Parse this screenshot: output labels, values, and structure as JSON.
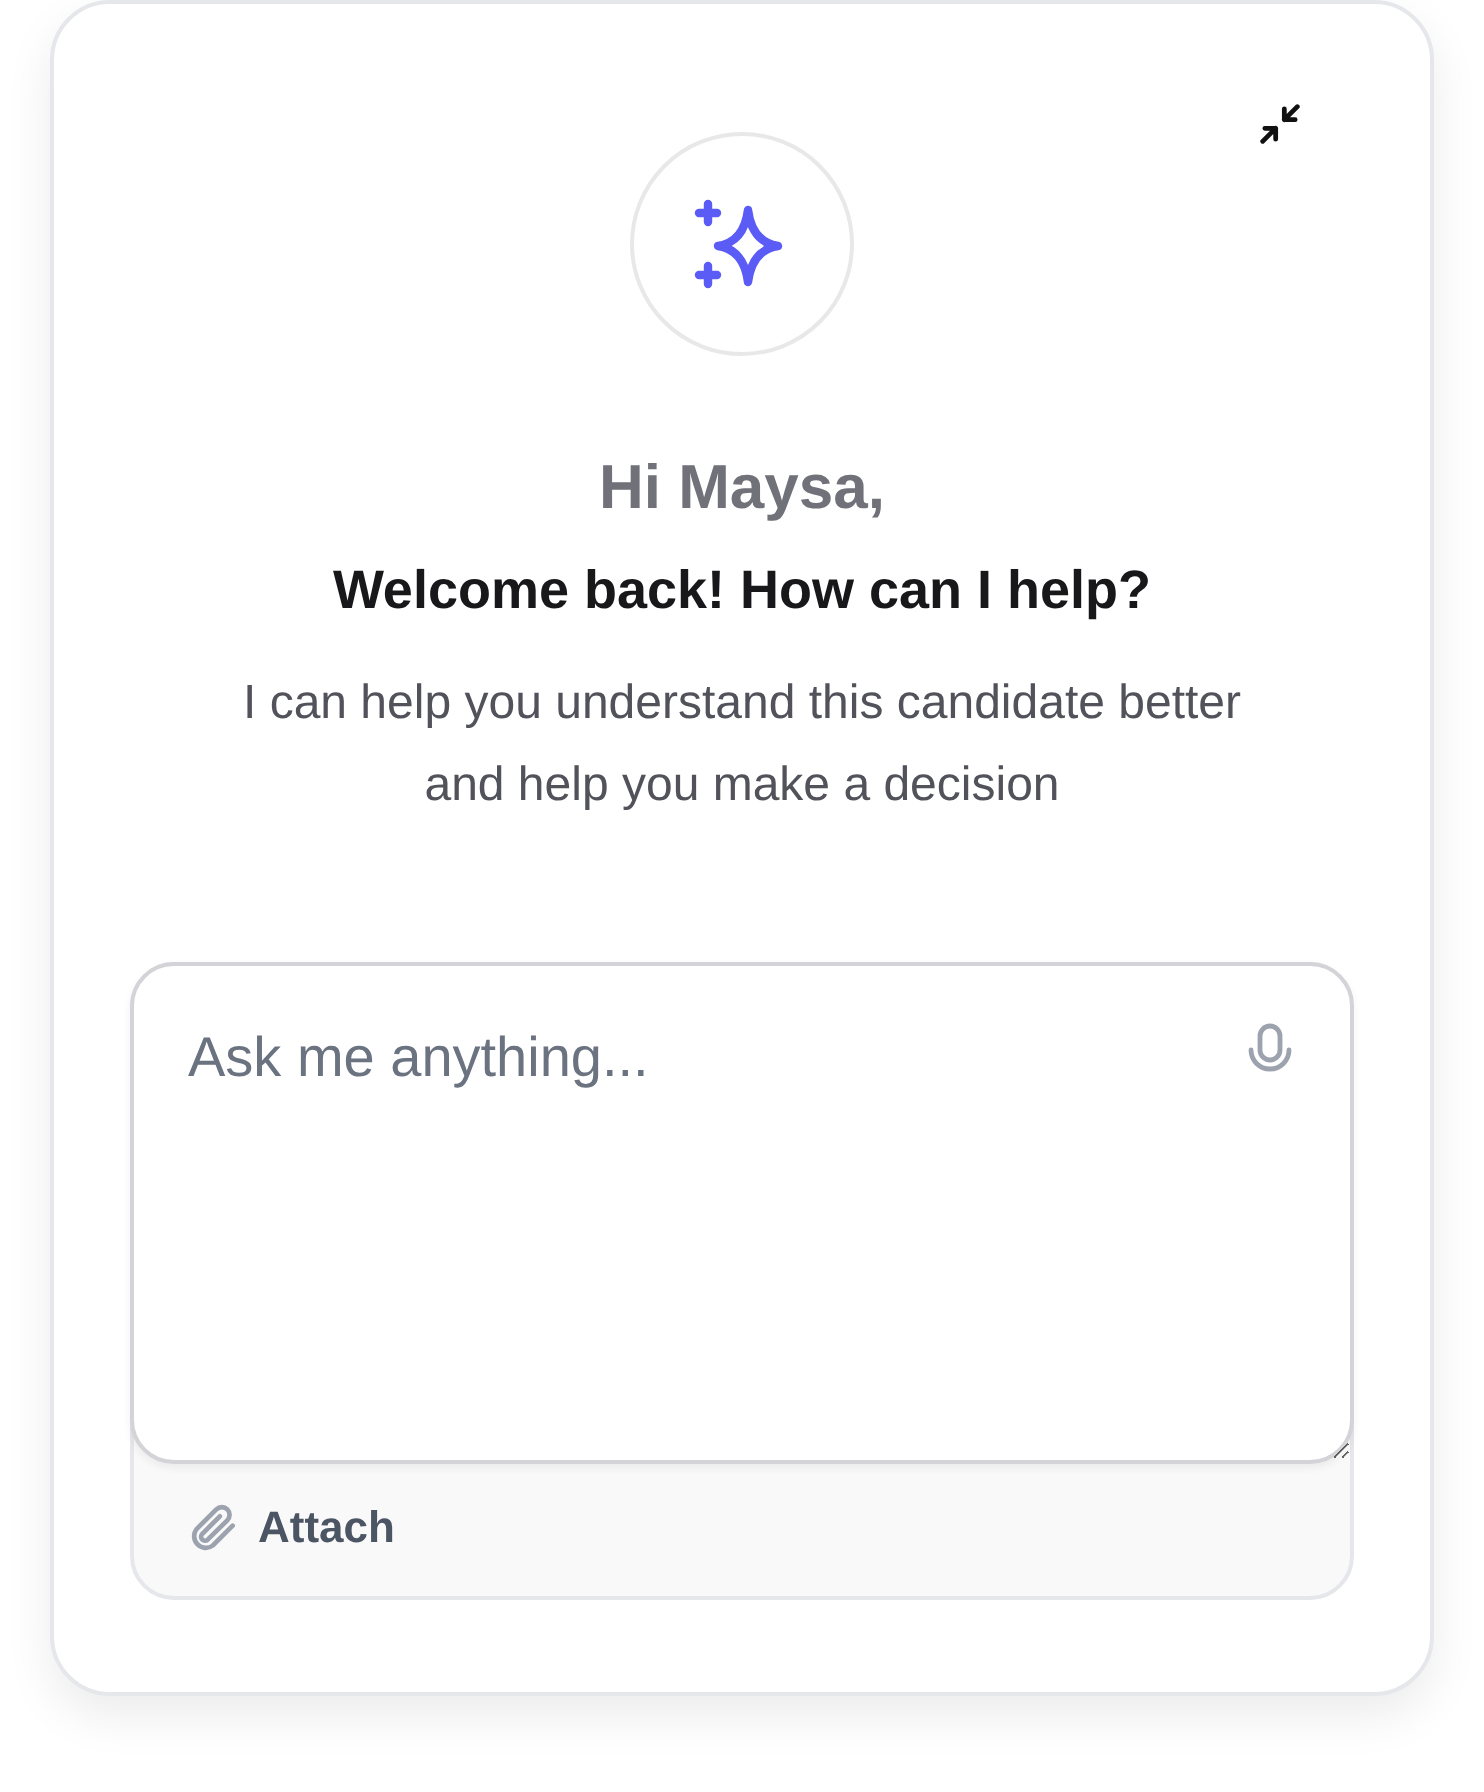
{
  "greeting": "Hi Maysa,",
  "heading": "Welcome back! How can I help?",
  "subtitle": "I can help you understand this candidate better and help you make a decision",
  "composer": {
    "placeholder": "Ask me anything...",
    "attach_label": "Attach"
  }
}
